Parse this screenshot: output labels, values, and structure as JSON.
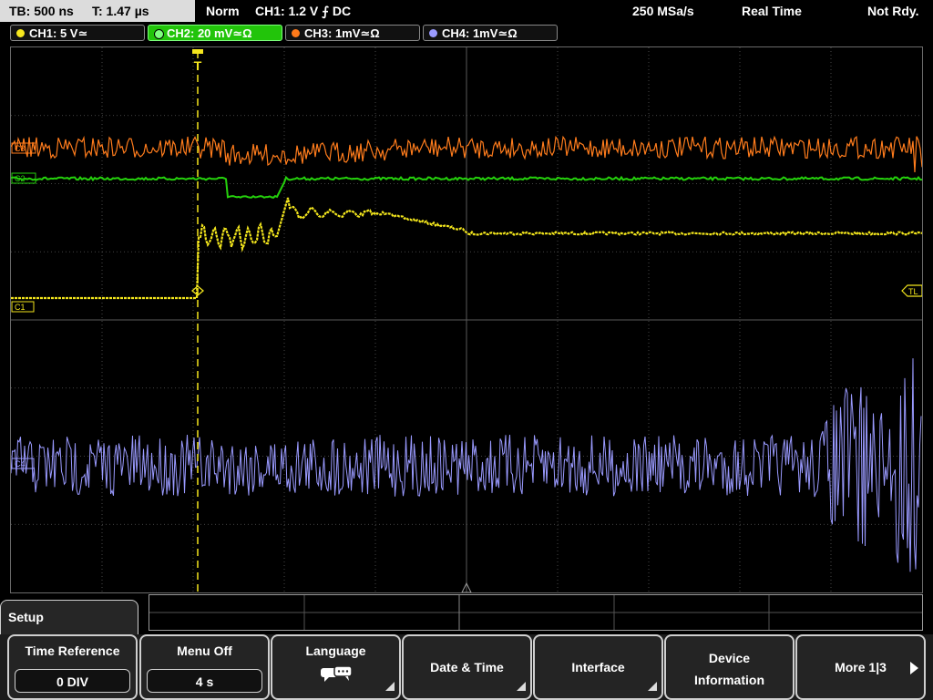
{
  "topbar": {
    "timebase": "TB: 500 ns",
    "trigger_time": "T: 1.47 µs",
    "mode": "Norm",
    "trigger": "CH1: 1.2 V ⨍ DC",
    "sample_rate": "250 MSa/s",
    "acq_mode": "Real Time",
    "status": "Not Rdy."
  },
  "channels": [
    {
      "label": "CH1: 5 V≃",
      "color": "#f5e61e",
      "active": false
    },
    {
      "label": "CH2: 20 mV≃Ω",
      "color": "#22c40a",
      "active": true
    },
    {
      "label": "CH3: 1mV≃Ω",
      "color": "#ff7a1a",
      "active": false
    },
    {
      "label": "CH4: 1mV≃Ω",
      "color": "#9a9aff",
      "active": false
    }
  ],
  "markers": {
    "ch1_level": "C1",
    "ch2_level": "C2",
    "ch3_level": "C3",
    "ch4_level": "C4",
    "trigger_level": "TL"
  },
  "trace_colors": {
    "ch1": "#f2e51c",
    "ch2": "#25d10c",
    "ch3": "#ff7c1c",
    "ch4": "#9a9aff",
    "trigger_marker": "#f5e61e",
    "grid": "#5a5a5a"
  },
  "menu": {
    "panel_title": "Setup",
    "softkeys": [
      {
        "title": "Time Reference",
        "value": "0 DIV"
      },
      {
        "title": "Menu Off",
        "value": "4 s"
      },
      {
        "title": "Language",
        "icon": "speech-bubbles-icon"
      },
      {
        "title": "Date & Time"
      },
      {
        "title": "Interface"
      },
      {
        "line1": "Device",
        "line2": "Information"
      },
      {
        "title": "More 1|3",
        "icon": "right-arrow-icon"
      }
    ]
  }
}
